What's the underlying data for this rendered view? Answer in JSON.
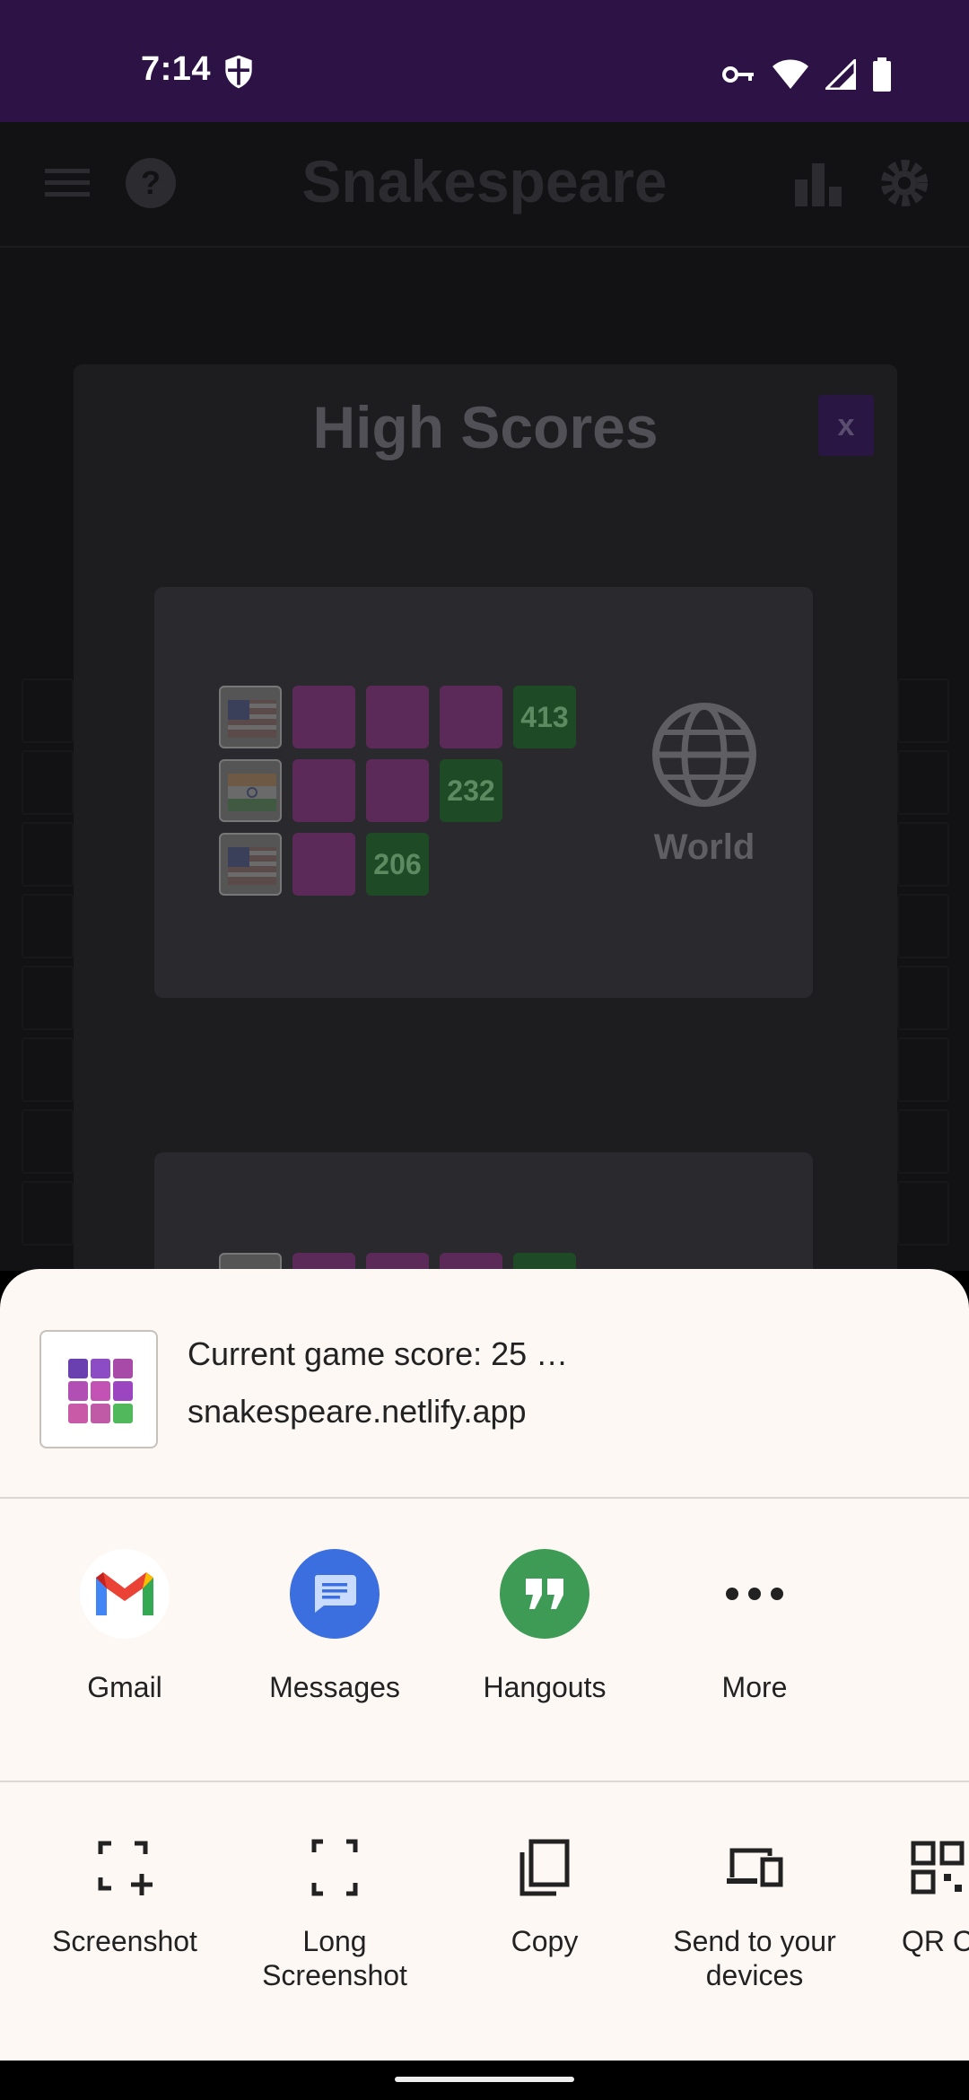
{
  "status_bar": {
    "time": "7:14"
  },
  "app": {
    "title": "Snakespeare",
    "modal": {
      "title": "High Scores",
      "close_label": "x",
      "world_label": "World",
      "rows": [
        {
          "flag": "us",
          "score": "413",
          "tiles": 3
        },
        {
          "flag": "in",
          "score": "232",
          "tiles": 2
        },
        {
          "flag": "us",
          "score": "206",
          "tiles": 1
        }
      ]
    }
  },
  "share_sheet": {
    "preview_title": "Current game score: 25 …",
    "preview_subtitle": "snakespeare.netlify.app",
    "targets": [
      {
        "label": "Gmail",
        "icon": "gmail-icon"
      },
      {
        "label": "Messages",
        "icon": "messages-icon",
        "color": "#3b6fe0"
      },
      {
        "label": "Hangouts",
        "icon": "hangouts-icon",
        "color": "#3d9b55"
      },
      {
        "label": "More",
        "icon": "more-icon"
      }
    ],
    "actions": [
      {
        "label": "Screenshot",
        "icon": "screenshot-icon"
      },
      {
        "label": "Long Screenshot",
        "icon": "long-screenshot-icon"
      },
      {
        "label": "Copy",
        "icon": "copy-icon"
      },
      {
        "label": "Send to your devices",
        "icon": "devices-icon"
      },
      {
        "label": "QR C",
        "icon": "qr-code-icon"
      }
    ]
  },
  "colors": {
    "status_bar": "#2c1245",
    "sheet_bg": "#fdf8f4"
  }
}
